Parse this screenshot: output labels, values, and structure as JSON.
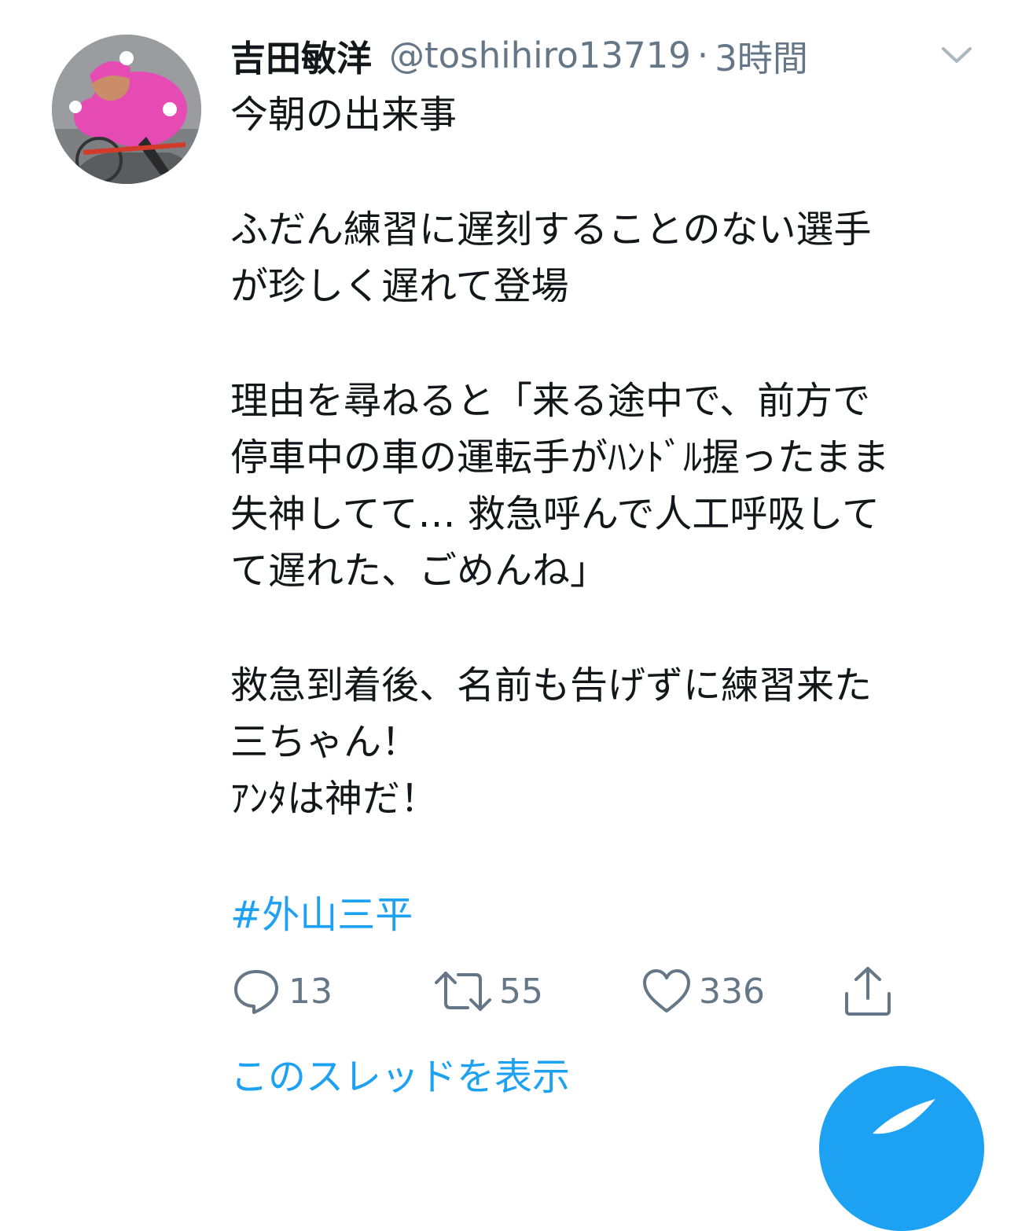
{
  "tweet": {
    "author": {
      "display_name": "吉田敏洋",
      "handle": "@toshihiro13719",
      "separator": "·",
      "time": "3時間"
    },
    "body_lines": [
      "今朝の出来事",
      "",
      "ふだん練習に遅刻することのない選手",
      "が珍しく遅れて登場",
      "",
      "理由を尋ねると「来る途中で、前方で",
      "停車中の車の運転手がﾊﾝﾄﾞﾙ握ったまま",
      "失神してて… 救急呼んで人工呼吸して",
      "て遅れた、ごめんね」",
      "",
      "救急到着後、名前も告げずに練習来た",
      "三ちゃん！",
      "ｱﾝﾀは神だ！"
    ],
    "hashtag": "#外山三平",
    "actions": {
      "reply_count": "13",
      "retweet_count": "55",
      "like_count": "336"
    },
    "show_thread": "このスレッドを表示",
    "icons": {
      "menu": "chevron-down-icon",
      "reply": "reply-icon",
      "retweet": "retweet-icon",
      "like": "heart-icon",
      "share": "share-icon",
      "compose": "compose-tweet-icon"
    },
    "colors": {
      "accent": "#1da1f2",
      "muted": "#657786",
      "text": "#14171a",
      "avatar_jersey": "#e64bb4"
    }
  }
}
